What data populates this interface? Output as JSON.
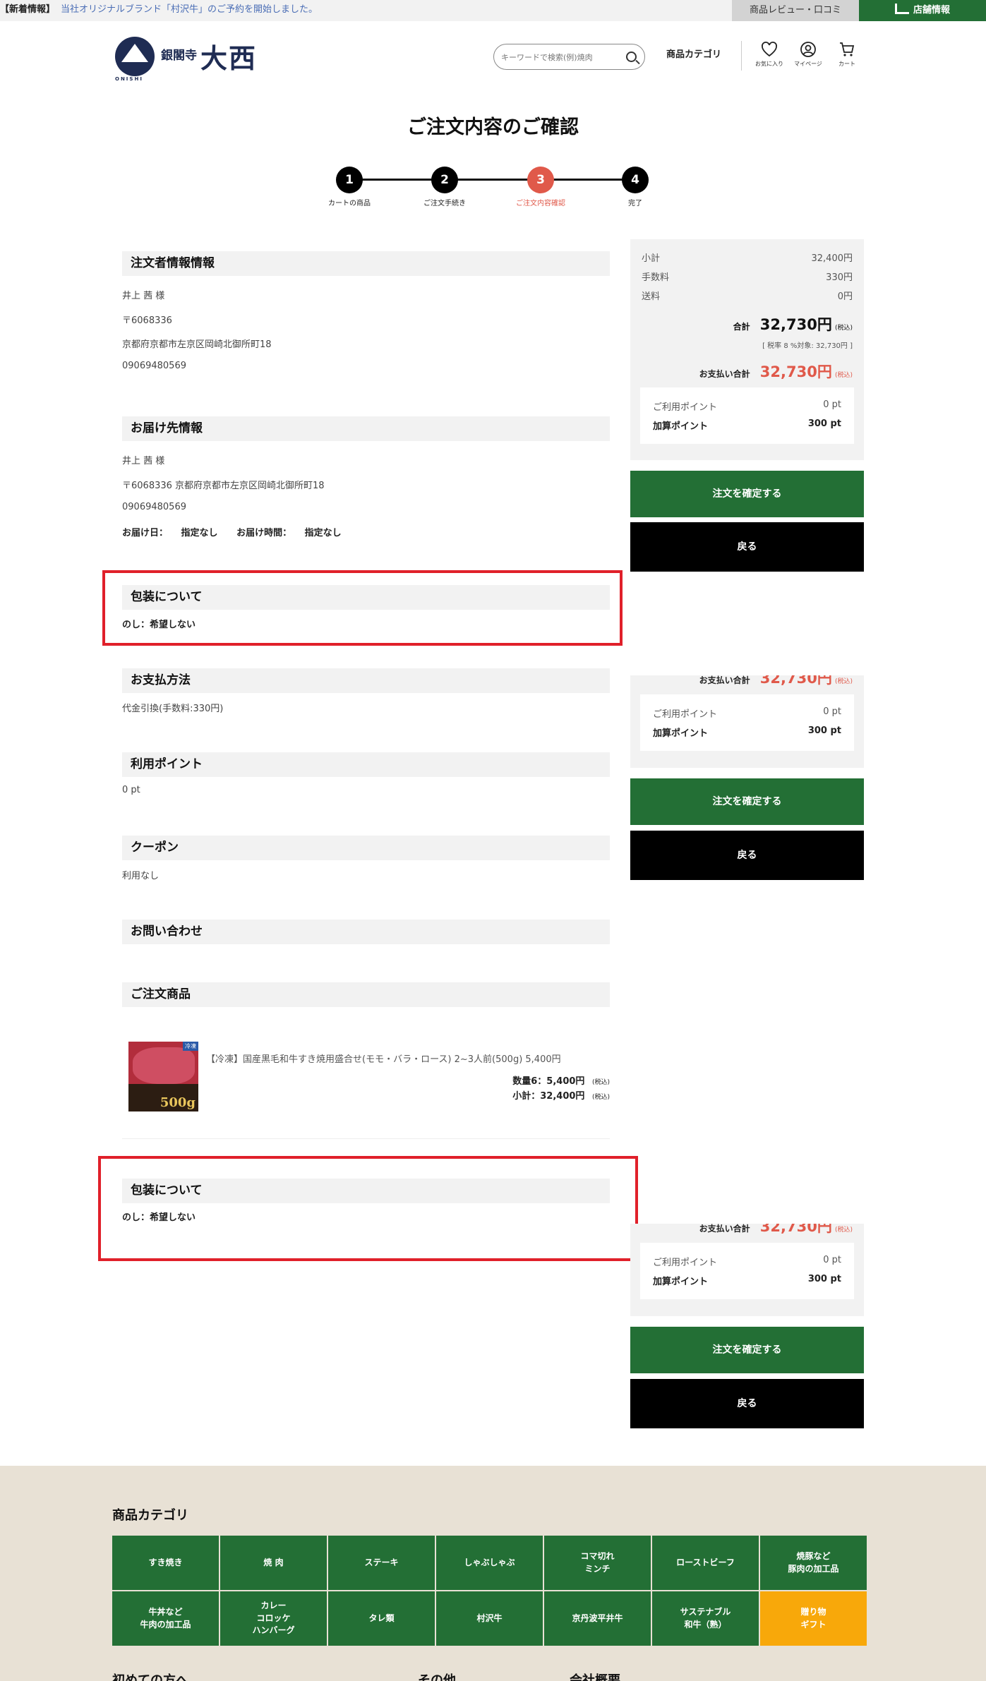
{
  "topbar": {
    "news_tag": "【新着情報】",
    "news_text": "当社オリジナルブランド「村沢牛」のご予約を開始しました。",
    "review_link": "商品レビュー・口コミ",
    "store_link": "店舗情報"
  },
  "header": {
    "logo_small": "銀閣寺",
    "logo_big": "大西",
    "logo_roman": "ONISHI",
    "search_placeholder": "キーワードで検索(例)焼肉",
    "category_link": "商品カテゴリ",
    "favorites_label": "お気に入り",
    "mypage_label": "マイページ",
    "cart_label": "カート"
  },
  "page_title": "ご注文内容のご確認",
  "steps": [
    {
      "num": "1",
      "label": "カートの商品"
    },
    {
      "num": "2",
      "label": "ご注文手続き"
    },
    {
      "num": "3",
      "label": "ご注文内容確認"
    },
    {
      "num": "4",
      "label": "完了"
    }
  ],
  "orderer": {
    "heading": "注文者情報情報",
    "name": "井上 茜 様",
    "zip": "〒6068336",
    "address": "京都府京都市左京区岡崎北御所町18",
    "phone": "09069480569"
  },
  "delivery": {
    "heading": "お届け先情報",
    "name": "井上 茜 様",
    "address": "〒6068336 京都府京都市左京区岡崎北御所町18",
    "phone": "09069480569",
    "date_label": "お届け日：",
    "date_value": "指定なし",
    "time_label": "お届け時間：",
    "time_value": "指定なし"
  },
  "wrapping": {
    "heading": "包装について",
    "noshi": "のし：希望しない"
  },
  "payment": {
    "heading": "お支払方法",
    "method": "代金引換(手数料:330円)"
  },
  "points_used": {
    "heading": "利用ポイント",
    "value": "0 pt"
  },
  "coupon": {
    "heading": "クーポン",
    "value": "利用なし"
  },
  "inquiry": {
    "heading": "お問い合わせ"
  },
  "products": {
    "heading": "ご注文商品",
    "items": [
      {
        "name": "【冷凍】国産黒毛和牛すき焼用盛合せ(モモ・バラ・ロース) 2~3人前(500g) 5,400円",
        "qty_line": "数量6：5,400円",
        "subtotal_line": "小計：32,400円",
        "tax": "(税込)",
        "img_badge": "冷凍",
        "img_text": "500g"
      }
    ]
  },
  "summary": {
    "subtotal_label": "小計",
    "subtotal_value": "32,400円",
    "fee_label": "手数料",
    "fee_value": "330円",
    "shipping_label": "送料",
    "shipping_value": "0円",
    "total_label": "合計",
    "total_value": "32,730円",
    "tax_in": "(税込)",
    "tax_note": "[ 税率 8 %対象: 32,730円 ]",
    "pay_label": "お支払い合計",
    "pay_value": "32,730円",
    "point_use_label": "ご利用ポイント",
    "point_use_value": "0 pt",
    "point_add_label": "加算ポイント",
    "point_add_value": "300 pt"
  },
  "buttons": {
    "confirm": "注文を確定する",
    "back": "戻る"
  },
  "footer": {
    "category_heading": "商品カテゴリ",
    "categories": [
      "すき焼き",
      "焼 肉",
      "ステーキ",
      "しゃぶしゃぶ",
      "コマ切れ\nミンチ",
      "ローストビーフ",
      "焼豚など\n豚肉の加工品",
      "牛丼など\n牛肉の加工品",
      "カレー\nコロッケ\nハンバーグ",
      "タレ類",
      "村沢牛",
      "京丹波平井牛",
      "サステナブル\n和牛（熟）",
      "贈り物\nギフト"
    ],
    "first_time": "初めての方へ",
    "other": "その他",
    "company": "会社概要"
  }
}
